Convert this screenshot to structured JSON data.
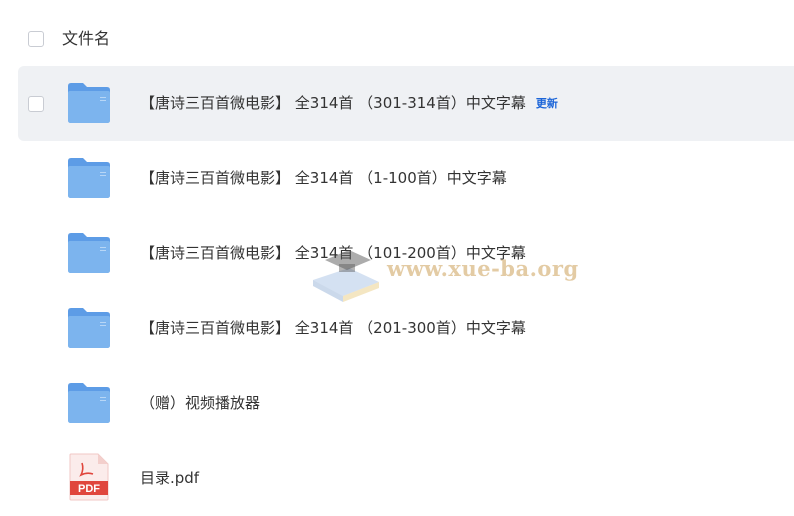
{
  "header": {
    "title": "文件名"
  },
  "files": [
    {
      "name": "【唐诗三百首微电影】 全314首 （301-314首）中文字幕",
      "type": "folder",
      "badge": "更新",
      "hovered": true
    },
    {
      "name": "【唐诗三百首微电影】 全314首 （1-100首）中文字幕",
      "type": "folder"
    },
    {
      "name": "【唐诗三百首微电影】 全314首 （101-200首）中文字幕",
      "type": "folder"
    },
    {
      "name": "【唐诗三百首微电影】 全314首 （201-300首）中文字幕",
      "type": "folder"
    },
    {
      "name": "（赠）视频播放器",
      "type": "folder"
    },
    {
      "name": "目录.pdf",
      "type": "pdf",
      "icon_label": "PDF"
    }
  ],
  "watermark": {
    "text": "www.xue-ba.org"
  },
  "colors": {
    "folder": "#7cb4ee",
    "folder_back": "#5d9ce6",
    "hover_bg": "#eff1f4",
    "badge": "#1c65d8",
    "pdf_red": "#e0463d"
  }
}
